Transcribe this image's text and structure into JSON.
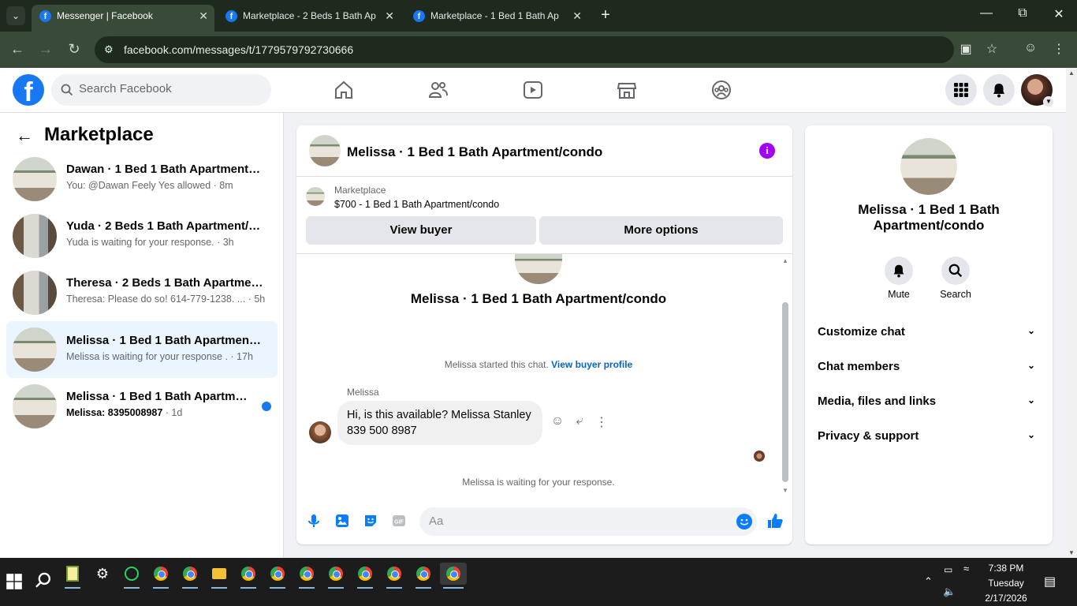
{
  "browser": {
    "tabs": [
      {
        "title": "Messenger | Facebook",
        "active": true
      },
      {
        "title": "Marketplace - 2 Beds 1 Bath Ap",
        "active": false
      },
      {
        "title": "Marketplace - 1 Bed 1 Bath Ap",
        "active": false
      }
    ],
    "url": "facebook.com/messages/t/1779579792730666"
  },
  "facebook": {
    "search_placeholder": "Search Facebook"
  },
  "sidebar": {
    "title": "Marketplace",
    "conversations": [
      {
        "name": "Dawan · 1 Bed 1 Bath Apartment/c...",
        "preview": "You: @Dawan Feely Yes allowed",
        "time": " · 8m",
        "unread": false,
        "selected": false
      },
      {
        "name": "Yuda · 2 Beds 1 Bath Apartment/co...",
        "preview": "Yuda is waiting for your response.",
        "time": " · 3h",
        "unread": false,
        "selected": false
      },
      {
        "name": "Theresa · 2 Beds 1 Bath Apartment...",
        "preview": "Theresa: Please do so! 614-779-1238. ...",
        "time": " · 5h",
        "unread": false,
        "selected": false
      },
      {
        "name": "Melissa · 1 Bed 1 Bath Apartment/c...",
        "preview": "Melissa is waiting for your response .",
        "time": " · 17h",
        "unread": false,
        "selected": true
      },
      {
        "name": "Melissa · 1 Bed 1 Bath Apartment...",
        "preview": "Melissa: 8395008987",
        "time": " · 1d",
        "unread": true,
        "selected": false
      }
    ]
  },
  "chat": {
    "title": "Melissa · 1 Bed 1 Bath Apartment/condo",
    "listing": {
      "label": "Marketplace",
      "price_title": "$700 - 1 Bed 1 Bath Apartment/condo"
    },
    "view_buyer": "View buyer",
    "more_options": "More options",
    "intro_name": "Melissa · 1 Bed 1 Bath Apartment/condo",
    "started_text": "Melissa started this chat.",
    "view_buyer_profile": "View buyer profile",
    "sender": "Melissa",
    "message_line1": "Hi, is this available? Melissa Stanley",
    "message_line2": "839 500 8987",
    "waiting": "Melissa is waiting for your response.",
    "composer_placeholder": "Aa"
  },
  "right_panel": {
    "name": "Melissa · 1 Bed 1 Bath Apartment/condo",
    "mute": "Mute",
    "search": "Search",
    "sections": [
      "Customize chat",
      "Chat members",
      "Media, files and links",
      "Privacy & support"
    ]
  },
  "taskbar": {
    "time": "7:38 PM",
    "day": "Tuesday",
    "date": "2/17/2026"
  },
  "colors": {
    "fb_blue": "#1877f2",
    "messenger_blue": "#0a7cff",
    "info_purple": "#a400f5"
  }
}
